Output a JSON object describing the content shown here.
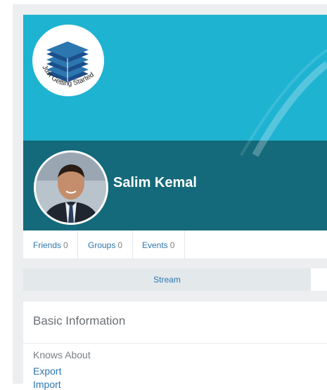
{
  "profile": {
    "name": "Salim Kemal",
    "logo_text": "Just Getting Started"
  },
  "stats": [
    {
      "label": "Friends",
      "count": "0"
    },
    {
      "label": "Groups",
      "count": "0"
    },
    {
      "label": "Events",
      "count": "0"
    }
  ],
  "tabs": {
    "stream_label": "Stream"
  },
  "basic_info": {
    "title": "Basic Information",
    "knows_about_label": "Knows About",
    "links": [
      "Export",
      "Import"
    ]
  },
  "colors": {
    "cover_top": "#1fb3d2",
    "cover_bottom": "#146a7a",
    "link": "#2d77b0",
    "page_bg": "#eceef0"
  },
  "icons": {
    "logo": "stacked-books-icon",
    "avatar": "user-photo"
  }
}
